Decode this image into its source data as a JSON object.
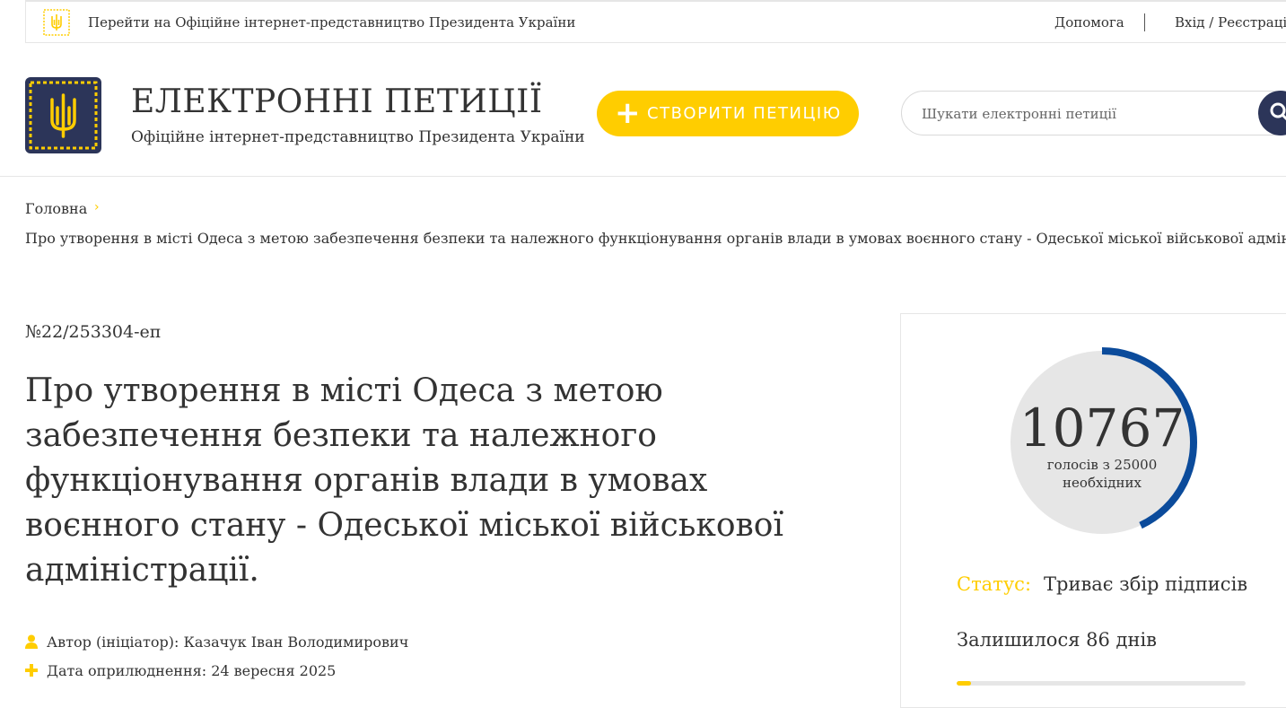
{
  "topbar": {
    "president_link": "Перейти на Офіційне інтернет-представництво Президента України",
    "help": "Допомога",
    "login": "Вхід / Реєстрація"
  },
  "header": {
    "title": "ЕЛЕКТРОННІ ПЕТИЦІЇ",
    "subtitle": "Офіційне інтернет-представництво Президента України",
    "create_button": "СТВОРИТИ ПЕТИЦІЮ",
    "search_placeholder": "Шукати електронні петиції"
  },
  "breadcrumb": {
    "home": "Головна",
    "current": "Про утворення в місті Одеса з метою забезпечення безпеки та належного функціонування органів влади в умовах воєнного стану - Одеської міської військової адміністрації."
  },
  "petition": {
    "number": "№22/253304-еп",
    "title": "Про утворення в місті Одеса з метою забезпечення безпеки та належного функціонування органів влади в умовах воєнного стану - Одеської міської військової адміністрації.",
    "author": "Автор (ініціатор): Казачук Іван Володимирович",
    "date": "Дата оприлюднення: 24 вересня 2025"
  },
  "stats": {
    "votes": "10767",
    "votes_caption": "голосів з 25000 необхідних",
    "votes_count": 10767,
    "votes_needed": 25000,
    "status_label": "Статус:",
    "status_value": "Триває збір підписів",
    "remaining": "Залишилося 86 днів",
    "time_progress_fraction": 0.05
  },
  "colors": {
    "accent_yellow": "#ffcd00",
    "navy": "#2c3559",
    "gauge_blue": "#0b4b9b",
    "gauge_bg": "#e6e6e6",
    "text": "#333333"
  }
}
